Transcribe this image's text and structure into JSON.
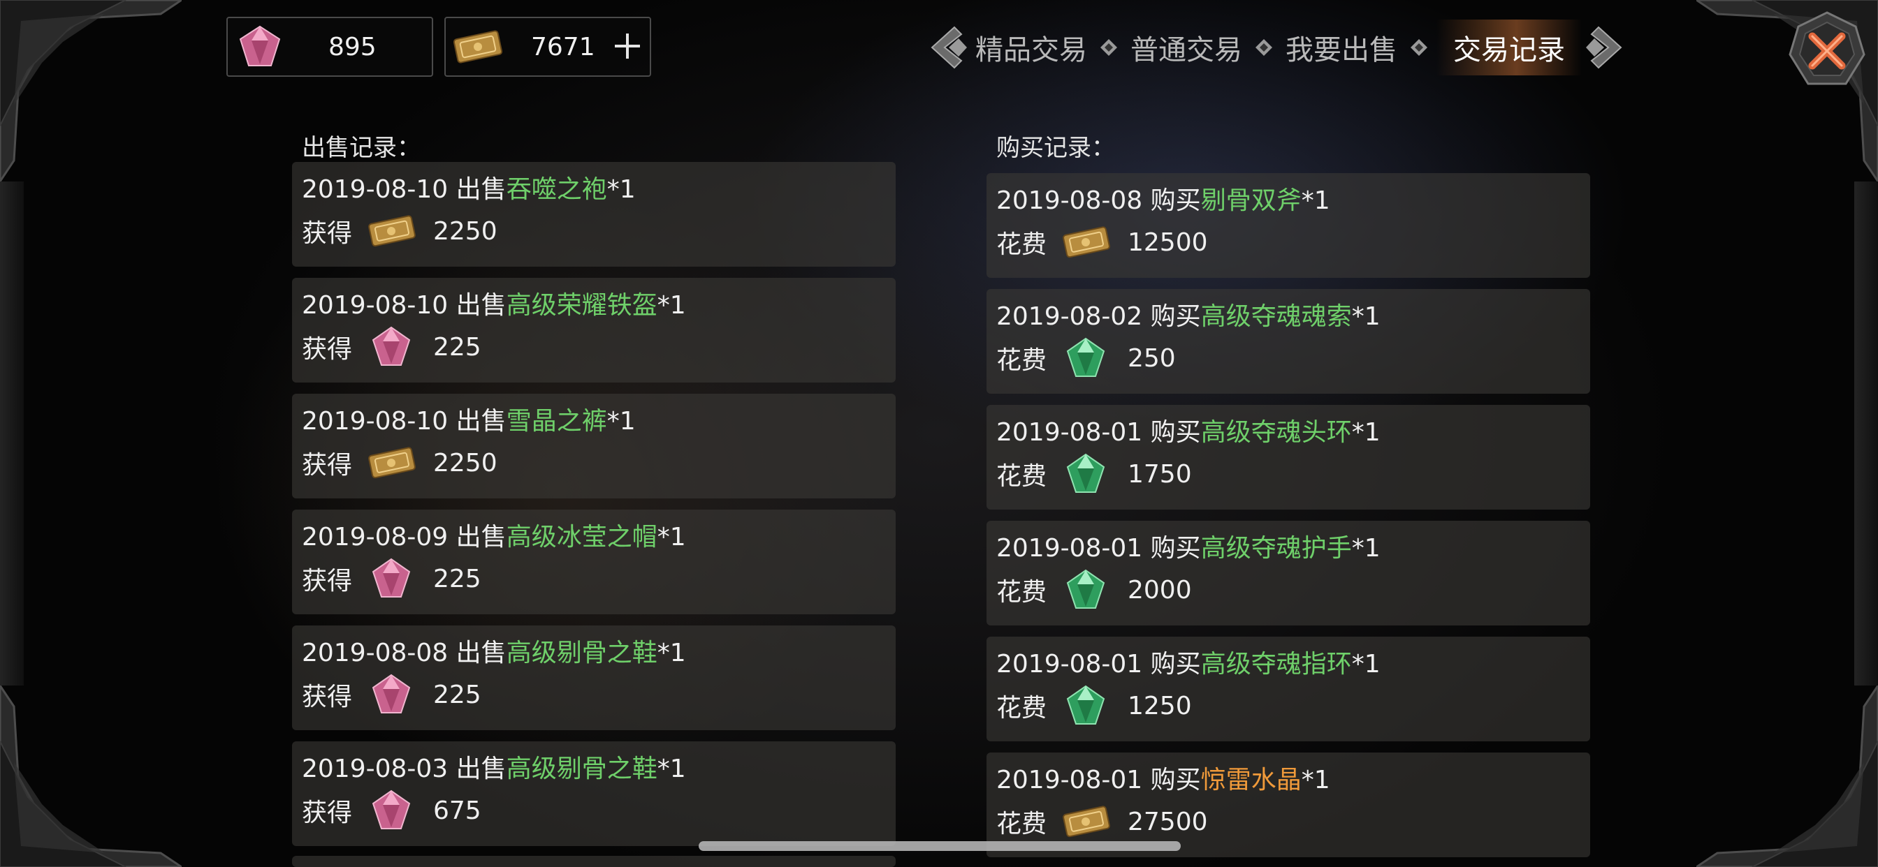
{
  "currency": {
    "gem": {
      "icon": "pink-gem-icon",
      "value": "895"
    },
    "ticket": {
      "icon": "gold-ticket-icon",
      "value": "7671"
    }
  },
  "tabs": [
    {
      "label": "精品交易",
      "active": false
    },
    {
      "label": "普通交易",
      "active": false
    },
    {
      "label": "我要出售",
      "active": false
    },
    {
      "label": "交易记录",
      "active": true
    }
  ],
  "sell": {
    "title": "出售记录：",
    "records": [
      {
        "date": "2019-08-10",
        "action": "出售",
        "item": "吞噬之袍",
        "qty": "*1",
        "label": "获得",
        "currency": "ticket",
        "amount": "2250"
      },
      {
        "date": "2019-08-10",
        "action": "出售",
        "item": "高级荣耀铁盔",
        "qty": "*1",
        "label": "获得",
        "currency": "gem",
        "amount": "225"
      },
      {
        "date": "2019-08-10",
        "action": "出售",
        "item": "雪晶之裤",
        "qty": "*1",
        "label": "获得",
        "currency": "ticket",
        "amount": "2250"
      },
      {
        "date": "2019-08-09",
        "action": "出售",
        "item": "高级冰莹之帽",
        "qty": "*1",
        "label": "获得",
        "currency": "gem",
        "amount": "225"
      },
      {
        "date": "2019-08-08",
        "action": "出售",
        "item": "高级剔骨之鞋",
        "qty": "*1",
        "label": "获得",
        "currency": "gem",
        "amount": "225"
      },
      {
        "date": "2019-08-03",
        "action": "出售",
        "item": "高级剔骨之鞋",
        "qty": "*1",
        "label": "获得",
        "currency": "gem",
        "amount": "675"
      }
    ]
  },
  "buy": {
    "title": "购买记录：",
    "records": [
      {
        "date": "2019-08-08",
        "action": "购买",
        "item": "剔骨双斧",
        "qty": "*1",
        "label": "花费",
        "currency": "ticket",
        "amount": "12500"
      },
      {
        "date": "2019-08-02",
        "action": "购买",
        "item": "高级夺魂魂索",
        "qty": "*1",
        "label": "花费",
        "currency": "green",
        "amount": "250"
      },
      {
        "date": "2019-08-01",
        "action": "购买",
        "item": "高级夺魂头环",
        "qty": "*1",
        "label": "花费",
        "currency": "green",
        "amount": "1750"
      },
      {
        "date": "2019-08-01",
        "action": "购买",
        "item": "高级夺魂护手",
        "qty": "*1",
        "label": "花费",
        "currency": "green",
        "amount": "2000"
      },
      {
        "date": "2019-08-01",
        "action": "购买",
        "item": "高级夺魂指环",
        "qty": "*1",
        "label": "花费",
        "currency": "green",
        "amount": "1250"
      },
      {
        "date": "2019-08-01",
        "action": "购买",
        "item": "惊雷水晶",
        "qty": "*1",
        "label": "花费",
        "currency": "ticket",
        "amount": "27500",
        "item_color": "orange"
      }
    ]
  },
  "colors": {
    "item_green": "#6fd06a",
    "item_orange": "#f09a3a",
    "active_tab_glow": "#a05a2d"
  }
}
